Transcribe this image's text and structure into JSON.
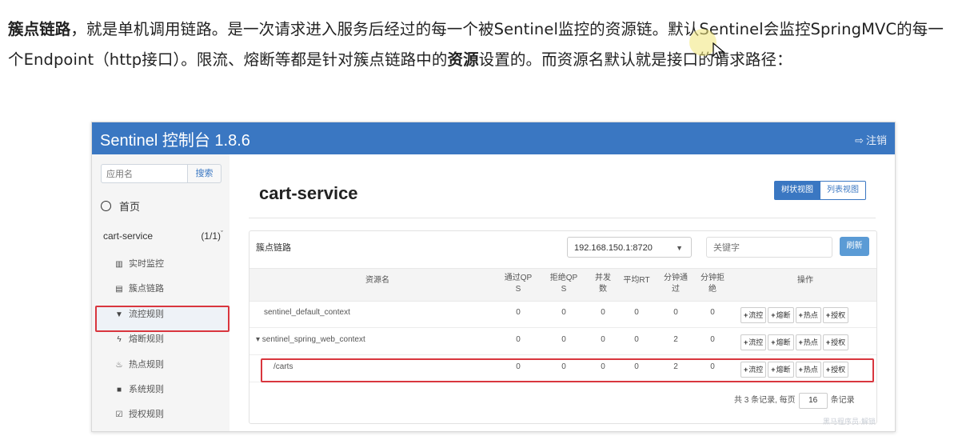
{
  "intro": {
    "bold1": "簇点链路",
    "text1": "，就是单机调用链路。是一次请求进入服务后经过的每一个被Sentinel监控的资源链。默认Sentinel会监控SpringMVC的每一个Endpoint（http接口）。限流、熔断等都是针对簇点链路中的",
    "bold2": "资源",
    "text2": "设置的。而资源名默认就是接口的请求路径："
  },
  "app": {
    "title": "Sentinel 控制台 1.8.6",
    "logout_label": "注销",
    "colors": {
      "topbar": "#3a77c2",
      "highlight": "#d9363e"
    }
  },
  "sidebar": {
    "search_placeholder": "应用名",
    "search_button": "搜索",
    "home_label": "首页",
    "app_name": "cart-service",
    "app_count": "(1/1)",
    "items": [
      {
        "label": "实时监控",
        "icon": "bar-chart-icon"
      },
      {
        "label": "簇点链路",
        "icon": "list-icon"
      },
      {
        "label": "流控规则",
        "icon": "filter-icon"
      },
      {
        "label": "熔断规则",
        "icon": "bolt-icon"
      },
      {
        "label": "热点规则",
        "icon": "fire-icon"
      },
      {
        "label": "系统规则",
        "icon": "lock-icon"
      },
      {
        "label": "授权规则",
        "icon": "check-icon"
      }
    ]
  },
  "main": {
    "title": "cart-service",
    "view_tree": "树状视图",
    "view_list": "列表视图",
    "panel_title": "簇点链路",
    "machine": "192.168.150.1:8720",
    "keyword_placeholder": "关键字",
    "refresh": "刷新",
    "columns": [
      "资源名",
      "通过QPS",
      "拒绝QPS",
      "并发数",
      "平均RT",
      "分钟通过",
      "分钟拒绝",
      "操作"
    ],
    "column_lines": [
      [
        "资源名"
      ],
      [
        "通过QP",
        "S"
      ],
      [
        "拒绝QP",
        "S"
      ],
      [
        "并发",
        "数"
      ],
      [
        "平均RT"
      ],
      [
        "分钟通",
        "过"
      ],
      [
        "分钟拒",
        "绝"
      ],
      [
        "操作"
      ]
    ],
    "rows": [
      {
        "name": "sentinel_default_context",
        "pass_qps": "0",
        "block_qps": "0",
        "concurrency": "0",
        "avg_rt": "0",
        "minute_pass": "0",
        "minute_block": "0"
      },
      {
        "name": "▾ sentinel_spring_web_context",
        "pass_qps": "0",
        "block_qps": "0",
        "concurrency": "0",
        "avg_rt": "0",
        "minute_pass": "2",
        "minute_block": "0"
      },
      {
        "name": "/carts",
        "pass_qps": "0",
        "block_qps": "0",
        "concurrency": "0",
        "avg_rt": "0",
        "minute_pass": "2",
        "minute_block": "0"
      }
    ],
    "ops": [
      "流控",
      "熔断",
      "热点",
      "授权"
    ],
    "footer_prefix": "共 3 条记录, 每页",
    "page_size": "16",
    "footer_suffix": "条记录",
    "watermark": "黑马程序员·解锁"
  }
}
